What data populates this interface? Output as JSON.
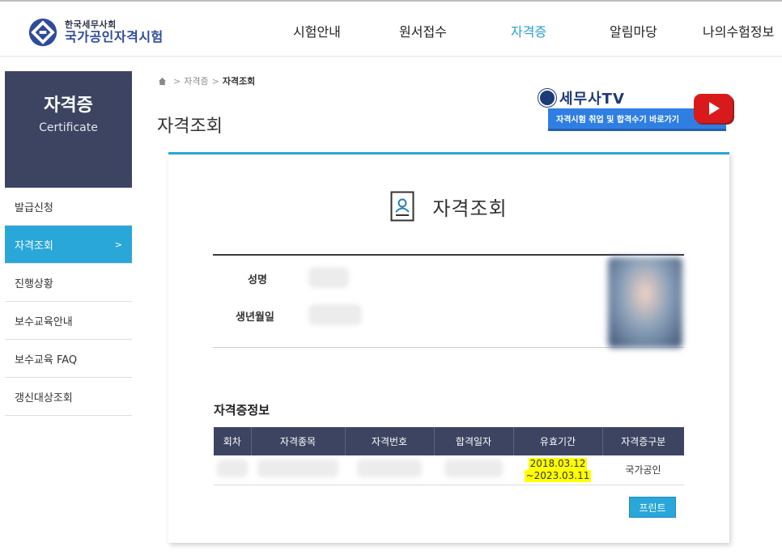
{
  "header": {
    "logo_top": "한국세무사회",
    "logo_bottom": "국가공인자격시험",
    "nav": [
      {
        "label": "시험안내"
      },
      {
        "label": "원서접수"
      },
      {
        "label": "자격증"
      },
      {
        "label": "알림마당"
      },
      {
        "label": "나의수험정보"
      }
    ],
    "active_nav": "자격증"
  },
  "sidebar": {
    "title": "자격증",
    "subtitle": "Certificate",
    "items": [
      {
        "label": "발급신청"
      },
      {
        "label": "자격조회",
        "arrow": ">"
      },
      {
        "label": "진행상황"
      },
      {
        "label": "보수교육안내"
      },
      {
        "label": "보수교육 FAQ"
      },
      {
        "label": "갱신대상조회"
      }
    ]
  },
  "breadcrumb": {
    "sep": ">",
    "parent": "자격증",
    "current": "자격조회"
  },
  "page_title": "자격조회",
  "tv_banner": {
    "logo": "세무사TV",
    "caption": "자격시험 취업 및 합격수기 바로가기"
  },
  "card": {
    "title": "자격조회",
    "profile": {
      "name_label": "성명",
      "birth_label": "생년월일"
    },
    "section_title": "자격증정보",
    "table": {
      "headers": [
        "회차",
        "자격종목",
        "자격번호",
        "합격일자",
        "유효기간",
        "자격증구분"
      ],
      "row": {
        "valid_from": "2018.03.12",
        "valid_to": "~2023.03.11",
        "type": "국가공인"
      }
    },
    "print_label": "프린트"
  },
  "colors": {
    "accent": "#2aa7d9",
    "navy": "#3c4461",
    "highlight": "#ffff00"
  }
}
